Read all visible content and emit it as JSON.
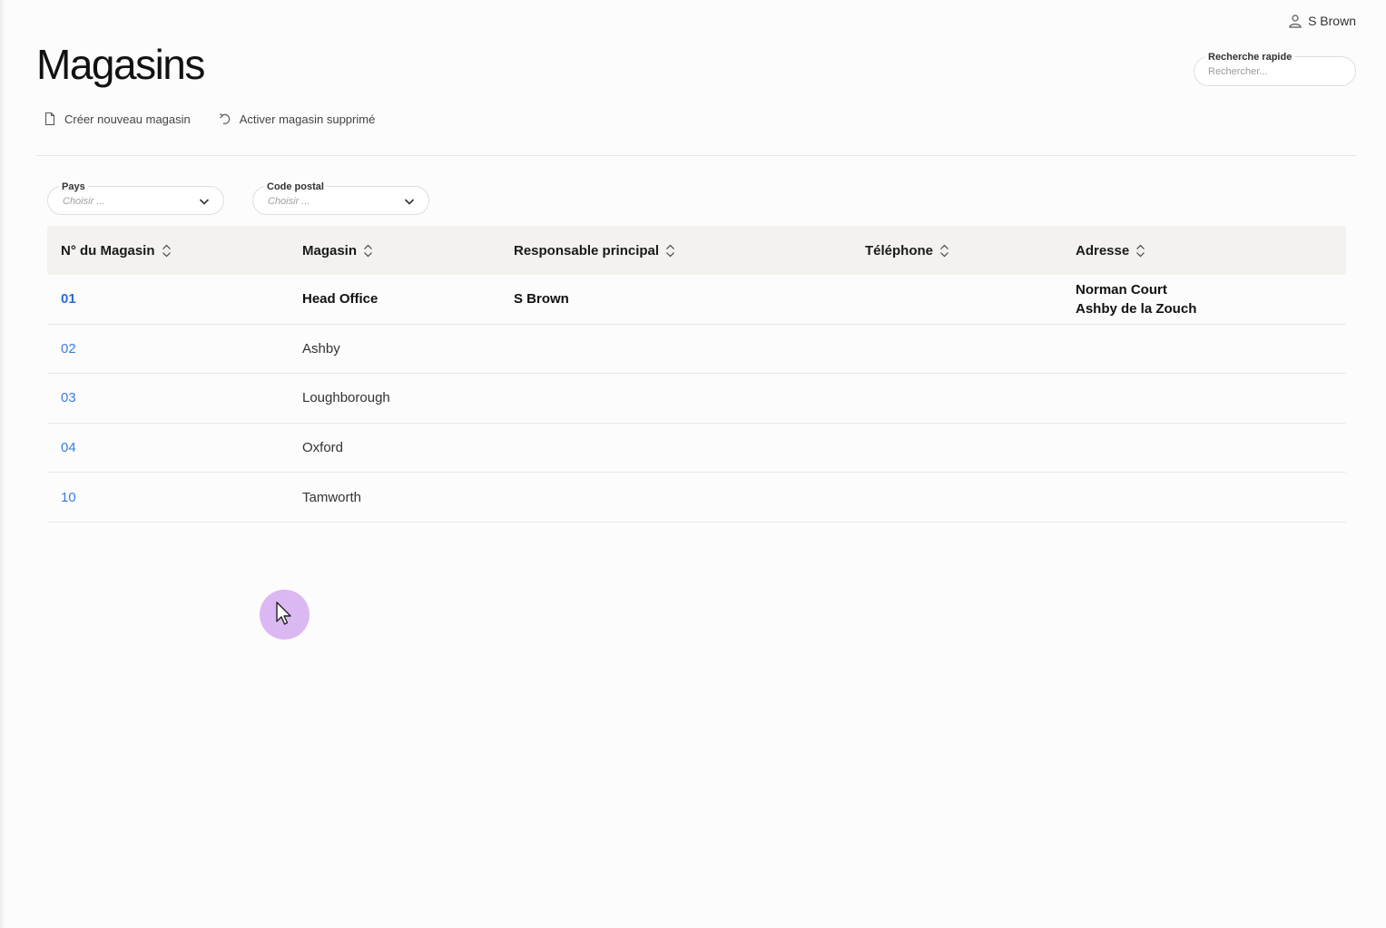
{
  "user": {
    "name": "S Brown",
    "icon": "user-icon"
  },
  "page": {
    "title": "Magasins"
  },
  "quick_search": {
    "label": "Recherche rapide",
    "placeholder": "Rechercher..."
  },
  "actions": {
    "create": {
      "label": "Créer nouveau magasin",
      "icon": "document-icon"
    },
    "restore": {
      "label": "Activer magasin supprimé",
      "icon": "undo-icon"
    }
  },
  "filters": {
    "country": {
      "label": "Pays",
      "value": "Choisir ..."
    },
    "postcode": {
      "label": "Code postal",
      "value": "Choisir ..."
    }
  },
  "table": {
    "columns": [
      "N° du Magasin",
      "Magasin",
      "Responsable principal",
      "Téléphone",
      "Adresse"
    ],
    "rows": [
      {
        "number": "01",
        "store": "Head Office",
        "manager": "S Brown",
        "phone": "",
        "address_line1": "Norman Court",
        "address_line2": "Ashby de la Zouch"
      },
      {
        "number": "02",
        "store": "Ashby",
        "manager": "",
        "phone": "",
        "address_line1": "",
        "address_line2": ""
      },
      {
        "number": "03",
        "store": "Loughborough",
        "manager": "",
        "phone": "",
        "address_line1": "",
        "address_line2": ""
      },
      {
        "number": "04",
        "store": "Oxford",
        "manager": "",
        "phone": "",
        "address_line1": "",
        "address_line2": ""
      },
      {
        "number": "10",
        "store": "Tamworth",
        "manager": "",
        "phone": "",
        "address_line1": "",
        "address_line2": ""
      }
    ]
  },
  "colors": {
    "link": "#3b7ddd",
    "header_bg": "#f3f2ef",
    "cursor_highlight": "#dcb8f2"
  }
}
